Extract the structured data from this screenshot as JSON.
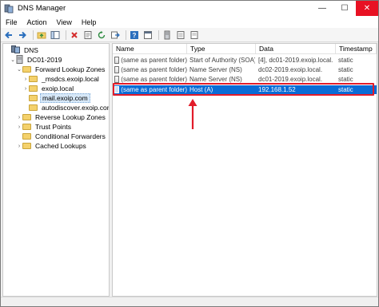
{
  "window": {
    "title": "DNS Manager",
    "icons": [
      "dns-app-icon"
    ],
    "controls": {
      "minimize": "—",
      "maximize": "☐",
      "close": "✕"
    }
  },
  "menu": [
    "File",
    "Action",
    "View",
    "Help"
  ],
  "toolbar": {
    "buttons": [
      "back-icon",
      "forward-icon",
      "up-folder-icon",
      "show-hide-tree-icon",
      "delete-icon",
      "properties-icon",
      "refresh-icon",
      "export-icon",
      "help-icon",
      "console-icon",
      "server-icon",
      "zone-icon",
      "record-icon"
    ]
  },
  "tree": {
    "root": "DNS",
    "server": "DC01-2019",
    "forward_zones": "Forward Lookup Zones",
    "zone_msdcs": "_msdcs.exoip.local",
    "zone_exoip": "exoip.local",
    "zone_mail": "mail.exoip.com",
    "zone_autodiscover": "autodiscover.exoip.com",
    "reverse_zones": "Reverse Lookup Zones",
    "trust_points": "Trust Points",
    "conditional_forwarders": "Conditional Forwarders",
    "cached_lookups": "Cached Lookups"
  },
  "list": {
    "columns": {
      "name": "Name",
      "type": "Type",
      "data": "Data",
      "timestamp": "Timestamp"
    },
    "rows": [
      {
        "name": "(same as parent folder)",
        "type": "Start of Authority (SOA)",
        "data": "[4], dc01-2019.exoip.local.",
        "timestamp": "static"
      },
      {
        "name": "(same as parent folder)",
        "type": "Name Server (NS)",
        "data": "dc02-2019.exoip.local.",
        "timestamp": "static"
      },
      {
        "name": "(same as parent folder)",
        "type": "Name Server (NS)",
        "data": "dc01-2019.exoip.local.",
        "timestamp": "static"
      },
      {
        "name": "(same as parent folder)",
        "type": "Host (A)",
        "data": "192.168.1.52",
        "timestamp": "static"
      }
    ]
  },
  "colors": {
    "selection": "#0a6cd6",
    "highlight_box": "#e21c2a",
    "arrow": "#e21c2a",
    "close_button": "#e81123",
    "folder": "#f4d16b"
  }
}
